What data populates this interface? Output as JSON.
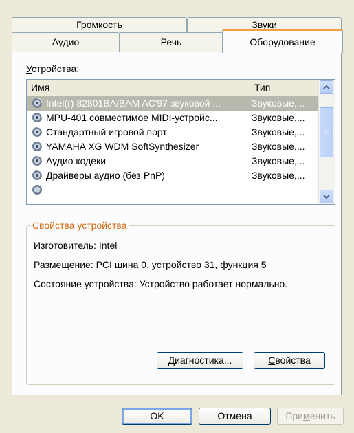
{
  "tabs": {
    "back_row": [
      {
        "label": "Громкость"
      },
      {
        "label": "Звуки"
      }
    ],
    "front_row": [
      {
        "label": "Аудио"
      },
      {
        "label": "Речь"
      },
      {
        "label": "Оборудование"
      }
    ]
  },
  "devices_label_prefix": "У",
  "devices_label_rest": "стройства:",
  "list": {
    "columns": {
      "name": "Имя",
      "type": "Тип"
    },
    "rows": [
      {
        "name": "Intel(r) 82801BA/BAM AC'97 звуковой ...",
        "type": "Звуковые,..."
      },
      {
        "name": "MPU-401 совместимое MIDI-устройс...",
        "type": "Звуковые,..."
      },
      {
        "name": "Стандартный игровой порт",
        "type": "Звуковые,..."
      },
      {
        "name": "YAMAHA XG WDM SoftSynthesizer",
        "type": "Звуковые,..."
      },
      {
        "name": "Аудио кодеки",
        "type": "Звуковые,..."
      },
      {
        "name": "Драйверы аудио (без PnP)",
        "type": "Звуковые,..."
      }
    ],
    "selected_index": 0,
    "icon": "speaker-icon"
  },
  "properties": {
    "title": "Свойства устройства",
    "manufacturer": "Изготовитель: Intel",
    "location": "Размещение: PCI шина 0, устройство 31, функция 5",
    "status": "Состояние устройства: Устройство работает нормально."
  },
  "panel_buttons": {
    "diagnostics_prefix": "Д",
    "diagnostics_rest": "иагностика...",
    "properties_prefix": "С",
    "properties_rest": "войства"
  },
  "dialog_buttons": {
    "ok": "OK",
    "cancel": "Отмена",
    "apply_pre": "При",
    "apply_ul": "м",
    "apply_post": "енить"
  },
  "colors": {
    "accent_tab": "#f0a03c",
    "group_title": "#d0690f",
    "selection": "#b9b8ad"
  }
}
